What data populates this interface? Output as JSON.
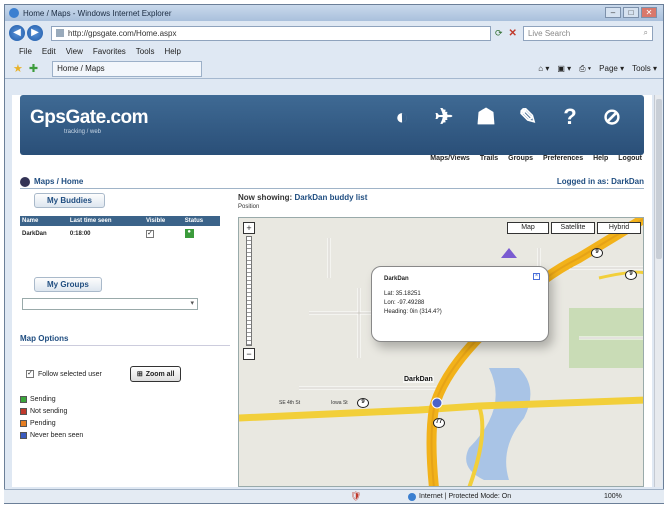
{
  "browser": {
    "title": "Home / Maps - Windows Internet Explorer",
    "url": "http://gpsgate.com/Home.aspx",
    "search_placeholder": "Live Search",
    "menu": [
      "File",
      "Edit",
      "View",
      "Favorites",
      "Tools",
      "Help"
    ],
    "tab": "Home / Maps",
    "commands": [
      "Page ▾",
      "Tools ▾"
    ],
    "status_zone": "Internet | Protected Mode: On",
    "zoom": "100%"
  },
  "header": {
    "logo": "GpsGate.com",
    "nav": [
      "Maps/Views",
      "Trails",
      "Groups",
      "Preferences",
      "Help",
      "Logout"
    ]
  },
  "breadcrumb": "Maps / Home",
  "logged_in": "Logged in as: DarkDan",
  "left": {
    "buddies_tab": "My Buddies",
    "columns": [
      "Name",
      "Last time seen",
      "Visible",
      "Status"
    ],
    "rows": [
      {
        "name": "DarkDan",
        "time": "0:18:00",
        "visible": "✓",
        "status": "●"
      }
    ],
    "groups_tab": "My Groups",
    "map_options_title": "Map Options",
    "follow_label": "Follow selected user",
    "zoom_all_label": "Zoom all",
    "legend": [
      {
        "label": "Sending",
        "color": "#3aa63a"
      },
      {
        "label": "Not sending",
        "color": "#c0392b"
      },
      {
        "label": "Pending",
        "color": "#e67e22"
      },
      {
        "label": "Never been seen",
        "color": "#3b5cc0"
      }
    ]
  },
  "map": {
    "now_showing_label": "Now showing:",
    "now_showing_value": "DarkDan buddy list",
    "position_label": "Position",
    "map_types": [
      "Map",
      "Satellite",
      "Hybrid"
    ],
    "bubble": {
      "name": "DarkDan",
      "lat": "Lat: 35.18251",
      "lon": "Lon: -97.49288",
      "heading": "Heading: 0in (314.4?)"
    },
    "pin_label": "DarkDan",
    "road_labels": [
      "SE 4th St",
      "Iowa St"
    ],
    "shields": [
      "9",
      "9",
      "9",
      "77"
    ]
  }
}
